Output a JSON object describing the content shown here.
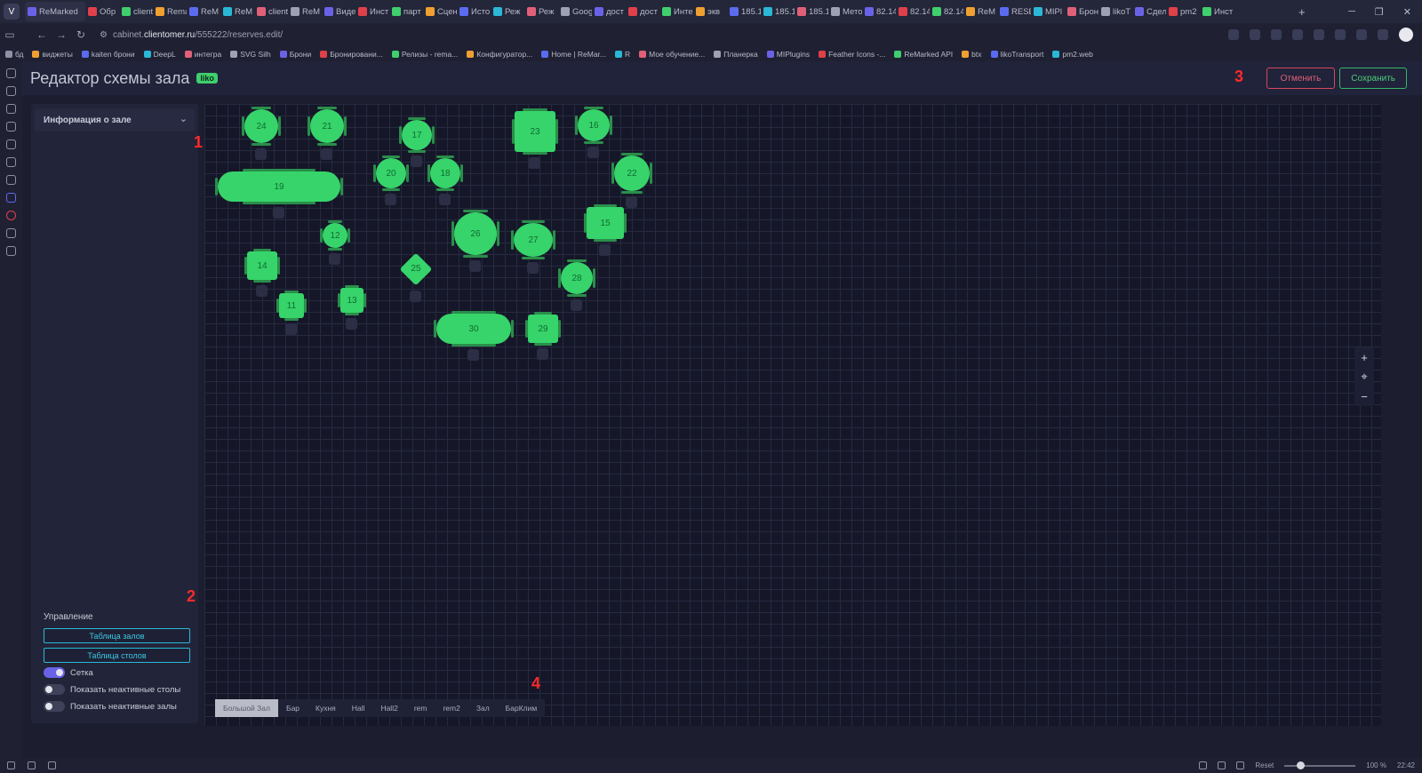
{
  "browser": {
    "tabs": [
      "ReMarked",
      "Обр",
      "client",
      "Rema",
      "ReM",
      "ReM",
      "client",
      "ReM",
      "Виде",
      "Инст",
      "парт",
      "Сцен",
      "Исто",
      "Реж",
      "Реж",
      "Goog",
      "дост",
      "дост",
      "Инте",
      "экв",
      "185.1",
      "185.1",
      "185.1",
      "Мето",
      "82.14",
      "82.14",
      "82.14",
      "ReM",
      "RESE",
      "MIPl",
      "Брон",
      "likoT",
      "Сдел",
      "pm2",
      "Инст"
    ],
    "url_prefix": "cabinet.",
    "url_domain": "clientomer.ru",
    "url_path": "/555222/reserves.edit/",
    "bookmarks": [
      "виджеты",
      "kaiten брони",
      "DeepL",
      "интегра",
      "SVG Silh",
      "Брони",
      "Бронировани...",
      "Релизы - rema...",
      "Конфигуратор...",
      "Home | ReMar...",
      "R",
      "Мое обучение...",
      "Планерка",
      "MIPlugins",
      "Feather Icons -...",
      "ReMarked API",
      "btx",
      "likoTransport",
      "pm2.web"
    ],
    "bookmark_folder": "бд",
    "status": {
      "reset": "Reset",
      "zoom": "100 %",
      "time": "22:42"
    }
  },
  "header": {
    "title": "Редактор схемы зала",
    "badge": "liko",
    "cancel": "Отменить",
    "save": "Сохранить"
  },
  "markers": {
    "m1": "1",
    "m2": "2",
    "m3": "3",
    "m4": "4"
  },
  "panel": {
    "info_title": "Информация о зале",
    "control_title": "Управление",
    "btn_halls": "Таблица залов",
    "btn_tables": "Таблица столов",
    "grid_label": "Сетка",
    "grid_on": true,
    "inactive_tables_label": "Показать неактивные столы",
    "inactive_tables_on": false,
    "inactive_halls_label": "Показать неактивные залы",
    "inactive_halls_on": false
  },
  "tables": [
    {
      "id": "24",
      "shape": "round"
    },
    {
      "id": "21",
      "shape": "round"
    },
    {
      "id": "17",
      "shape": "round"
    },
    {
      "id": "23",
      "shape": "square"
    },
    {
      "id": "16",
      "shape": "round"
    },
    {
      "id": "19",
      "shape": "pill"
    },
    {
      "id": "20",
      "shape": "round"
    },
    {
      "id": "18",
      "shape": "round"
    },
    {
      "id": "22",
      "shape": "round"
    },
    {
      "id": "12",
      "shape": "round"
    },
    {
      "id": "26",
      "shape": "round"
    },
    {
      "id": "27",
      "shape": "round"
    },
    {
      "id": "15",
      "shape": "square"
    },
    {
      "id": "14",
      "shape": "square"
    },
    {
      "id": "25",
      "shape": "diamond"
    },
    {
      "id": "28",
      "shape": "round"
    },
    {
      "id": "11",
      "shape": "square"
    },
    {
      "id": "13",
      "shape": "square"
    },
    {
      "id": "30",
      "shape": "pill"
    },
    {
      "id": "29",
      "shape": "square"
    }
  ],
  "hall_tabs": [
    "Большой Зал",
    "Бар",
    "Кухня",
    "Hall",
    "Hall2",
    "rem",
    "rem2",
    "Зал",
    "БарКлим"
  ],
  "active_hall": "Большой Зал",
  "colors": {
    "table": "#36d46a",
    "accent": "#6a62e6",
    "cancel": "#d7465f",
    "save": "#37b766",
    "control_btn": "#2ab8d6"
  },
  "icons": {
    "zoom_in": "+",
    "center": "⌖",
    "zoom_out": "−",
    "chevron": "⌄"
  }
}
